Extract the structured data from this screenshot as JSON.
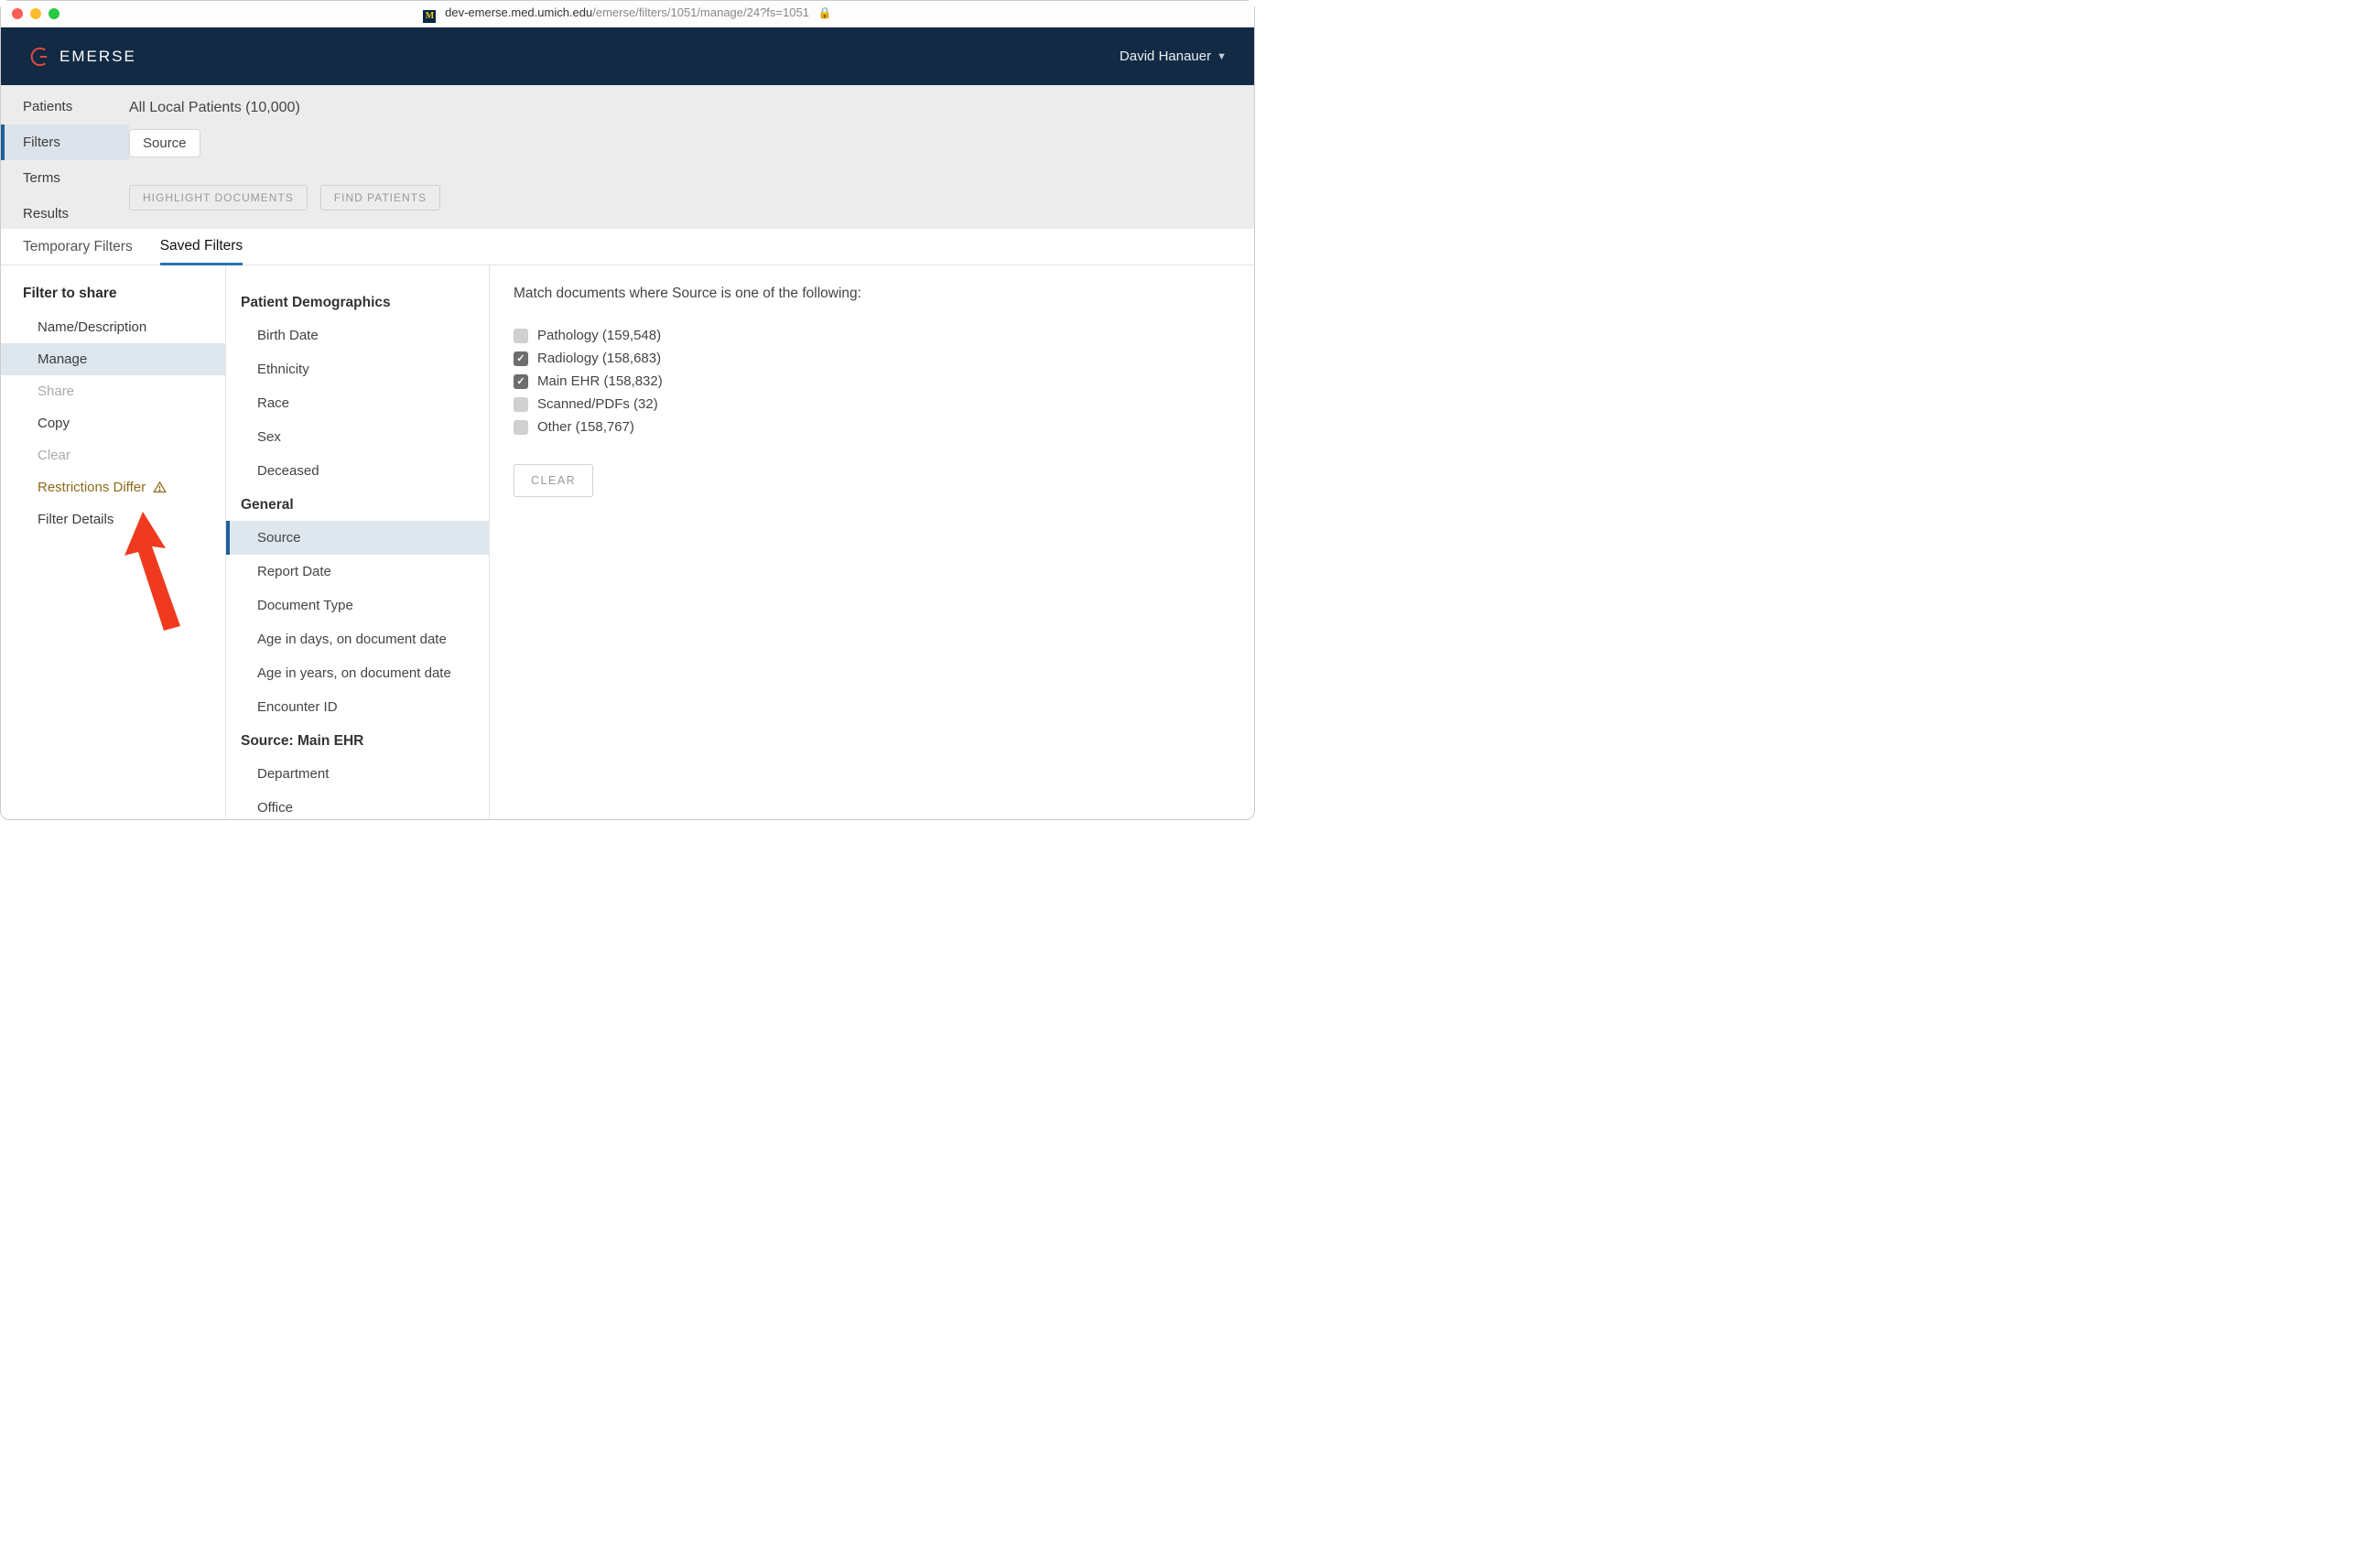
{
  "titlebar": {
    "favicon_letter": "M",
    "host": "dev-emerse.med.umich.edu",
    "path": "/emerse/filters/1051/manage/24?fs=1051"
  },
  "header": {
    "brand": "EMERSE",
    "user": "David Hanauer"
  },
  "left_rail": {
    "items": [
      "Patients",
      "Filters",
      "Terms",
      "Results"
    ],
    "active_index": 1
  },
  "tools": {
    "patients_summary": "All Local Patients (10,000)",
    "pill": "Source",
    "highlight_btn": "HIGHLIGHT DOCUMENTS",
    "find_btn": "FIND PATIENTS"
  },
  "subtabs": {
    "items": [
      "Temporary Filters",
      "Saved Filters"
    ],
    "active_index": 1
  },
  "col1": {
    "heading": "Filter to share",
    "items": [
      {
        "label": "Name/Description"
      },
      {
        "label": "Manage",
        "selected": true
      },
      {
        "label": "Share",
        "disabled": true
      },
      {
        "label": "Copy"
      },
      {
        "label": "Clear",
        "disabled": true
      },
      {
        "label": "Restrictions Differ",
        "warn": true
      },
      {
        "label": "Filter Details"
      }
    ]
  },
  "col2": {
    "groups": [
      {
        "heading": "Patient Demographics",
        "items": [
          "Birth Date",
          "Ethnicity",
          "Race",
          "Sex",
          "Deceased"
        ]
      },
      {
        "heading": "General",
        "items": [
          "Source",
          "Report Date",
          "Document Type",
          "Age in days, on document date",
          "Age in years, on document date",
          "Encounter ID"
        ],
        "selected_index": 0
      },
      {
        "heading": "Source: Main EHR",
        "items": [
          "Department",
          "Office"
        ]
      }
    ]
  },
  "col3": {
    "prompt": "Match documents where Source is one of the following:",
    "options": [
      {
        "label": "Pathology (159,548)",
        "checked": false
      },
      {
        "label": "Radiology (158,683)",
        "checked": true
      },
      {
        "label": "Main EHR (158,832)",
        "checked": true
      },
      {
        "label": "Scanned/PDFs (32)",
        "checked": false
      },
      {
        "label": "Other (158,767)",
        "checked": false
      }
    ],
    "clear_btn": "CLEAR"
  }
}
